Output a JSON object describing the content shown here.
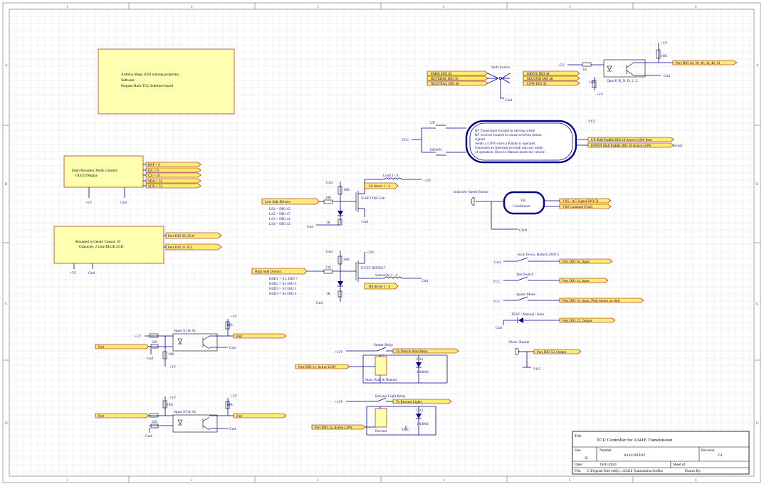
{
  "zones": {
    "columns": [
      "1",
      "2",
      "3",
      "4",
      "5",
      "6"
    ],
    "rows": [
      "A",
      "B",
      "C",
      "D"
    ]
  },
  "blocks": {
    "arduino": [
      "Arduino Mega 2650 running proprietry",
      " Software",
      "Purpose Built TCU Interface board"
    ],
    "oled": [
      "Dash Mounted, Multi Colored",
      "OLED Display"
    ],
    "lcd": [
      "Mounted in Centre Consul, 16",
      "Character, 2 Line BLUE LCD"
    ],
    "rf": [
      "RF Transmitter located in steering wheel",
      "RF receiver located in consul receives button",
      " signals",
      "Sends a LOW when a Paddle is operated",
      "Generates an Interrupt to break into any mode",
      "of operation. Once in Manual mode the vehicle"
    ],
    "vr": [
      "VR",
      "Conditioner"
    ]
  },
  "ports": {
    "oled": [
      "RST = 0",
      "DC = 9",
      "CS = 10",
      "SDA = 51",
      "SCK = 52"
    ],
    "lcd": [
      "Port DIO 20, SCA",
      "Port DIO 21 SCL"
    ],
    "shift_in": [
      "PARK DIO 44",
      "REVERSE DIO 36",
      "NEUTRAL DIO 46"
    ],
    "shift_out": [
      "DRIVE DIO 34",
      "SECOND DIO 48",
      "LOW DIO 32"
    ],
    "opto_port": "Port DIO 44, 36, 46, 34, 48, 32",
    "paddle": [
      "UP Shift Paddle DIO 19 Active LOW Inter",
      "DOWN Shift Paddle DIO 18 Active LOW"
    ],
    "low_side": "Low Side Drivers",
    "ls_driver": "LS driver 1 - 4",
    "high_side": "High Side Drivers",
    "hs_driver": "HS driver 1 - 4",
    "vss": [
      "VSS - AC Signal DIO 58",
      "VSS Common (Gnd)"
    ],
    "switches": [
      "Port DIO 50, Input",
      "Port DIO 14, Input",
      "Port DIO 16, Input, Push button on shift",
      "Port DIO  15, Output"
    ],
    "buzzer": "Port DIO 53, Output",
    "spare1_out": "Port",
    "spare1_in": "Port",
    "spare2_out": "Port",
    "spare2_in": "Port",
    "starter_out": "To Vehicle Start Relay",
    "starter_in": "Port DIO 11, Active LOW",
    "reverse_out": "To Reverse Lights",
    "reverse_in": "Port DIO 12, Active LOW"
  },
  "labels": {
    "shift_switch": "Shift Switch",
    "opto": "Opto P, R, N, D, 2, L",
    "up": "UP",
    "down": "DOWN",
    "nfet": "N-FET IRF-540",
    "load": "Load 1 - 4",
    "pfet": "P-FET IRF9Z37",
    "solenoid": "Solenoids 1 - 4",
    "ls_list": [
      "LS1 = DIO 45",
      "LS2 = DIO 47",
      "LS3 = DIO 41",
      "LS4 = DIO 43"
    ],
    "hs_list": [
      "HSD1 = S1, DIO 7",
      "HSD2 = S2 DIO 6",
      "HSD3 = S3 DIO 5",
      "HSD4 = S4 DIO 4"
    ],
    "inductive": "Inductive Speed Sensor",
    "kickdown": "Kick Down, Haltech DOP 2",
    "test_switch": "Test Switch",
    "sports": "Sports Mode",
    "test_manual": "TEST / Manual / Auto",
    "piezo": "Piezo. Buzzer",
    "spare12": "Spare S1 & S2",
    "spare34": "Spare S3 & S4",
    "starter_relay": "Starter Relay",
    "start_park": "Start, Park & Neutral",
    "reverse_relay": "Reverse Light Relay",
    "reverse": "Reverse",
    "d14": "D14",
    "d13": "D13",
    "diode": "1N4004",
    "interrupt": "errupt",
    "ohms": {
      "r10k": "10K",
      "r1k": "1K",
      "r330": "330",
      "r180": "180"
    }
  },
  "power": {
    "p5v": "+5V",
    "gnd": "Gnd",
    "vcc": "VCC",
    "p12v": "+12V",
    "gnd_caps": "GND"
  },
  "title_block": {
    "title_label": "Title",
    "title": "TCU Controller for A341E Transmission",
    "size_label": "Size",
    "size": "B",
    "number_label": "Number",
    "number": "A341/2019/02",
    "revision_label": "Revision",
    "revision": "C4",
    "date_label": "Date:",
    "date": "18/01/2020",
    "sheet_label": "Sheet    of",
    "file_label": "File:",
    "file": "C:\\Program Files (x86)\\...\\A341E Transmission.SchDoc",
    "drawn_label": "Drawn By:"
  },
  "colors": {
    "wire": "#00008b",
    "port_fill": "#ffec6e",
    "component_fill": "#ffffb0",
    "border": "#8b0000"
  }
}
